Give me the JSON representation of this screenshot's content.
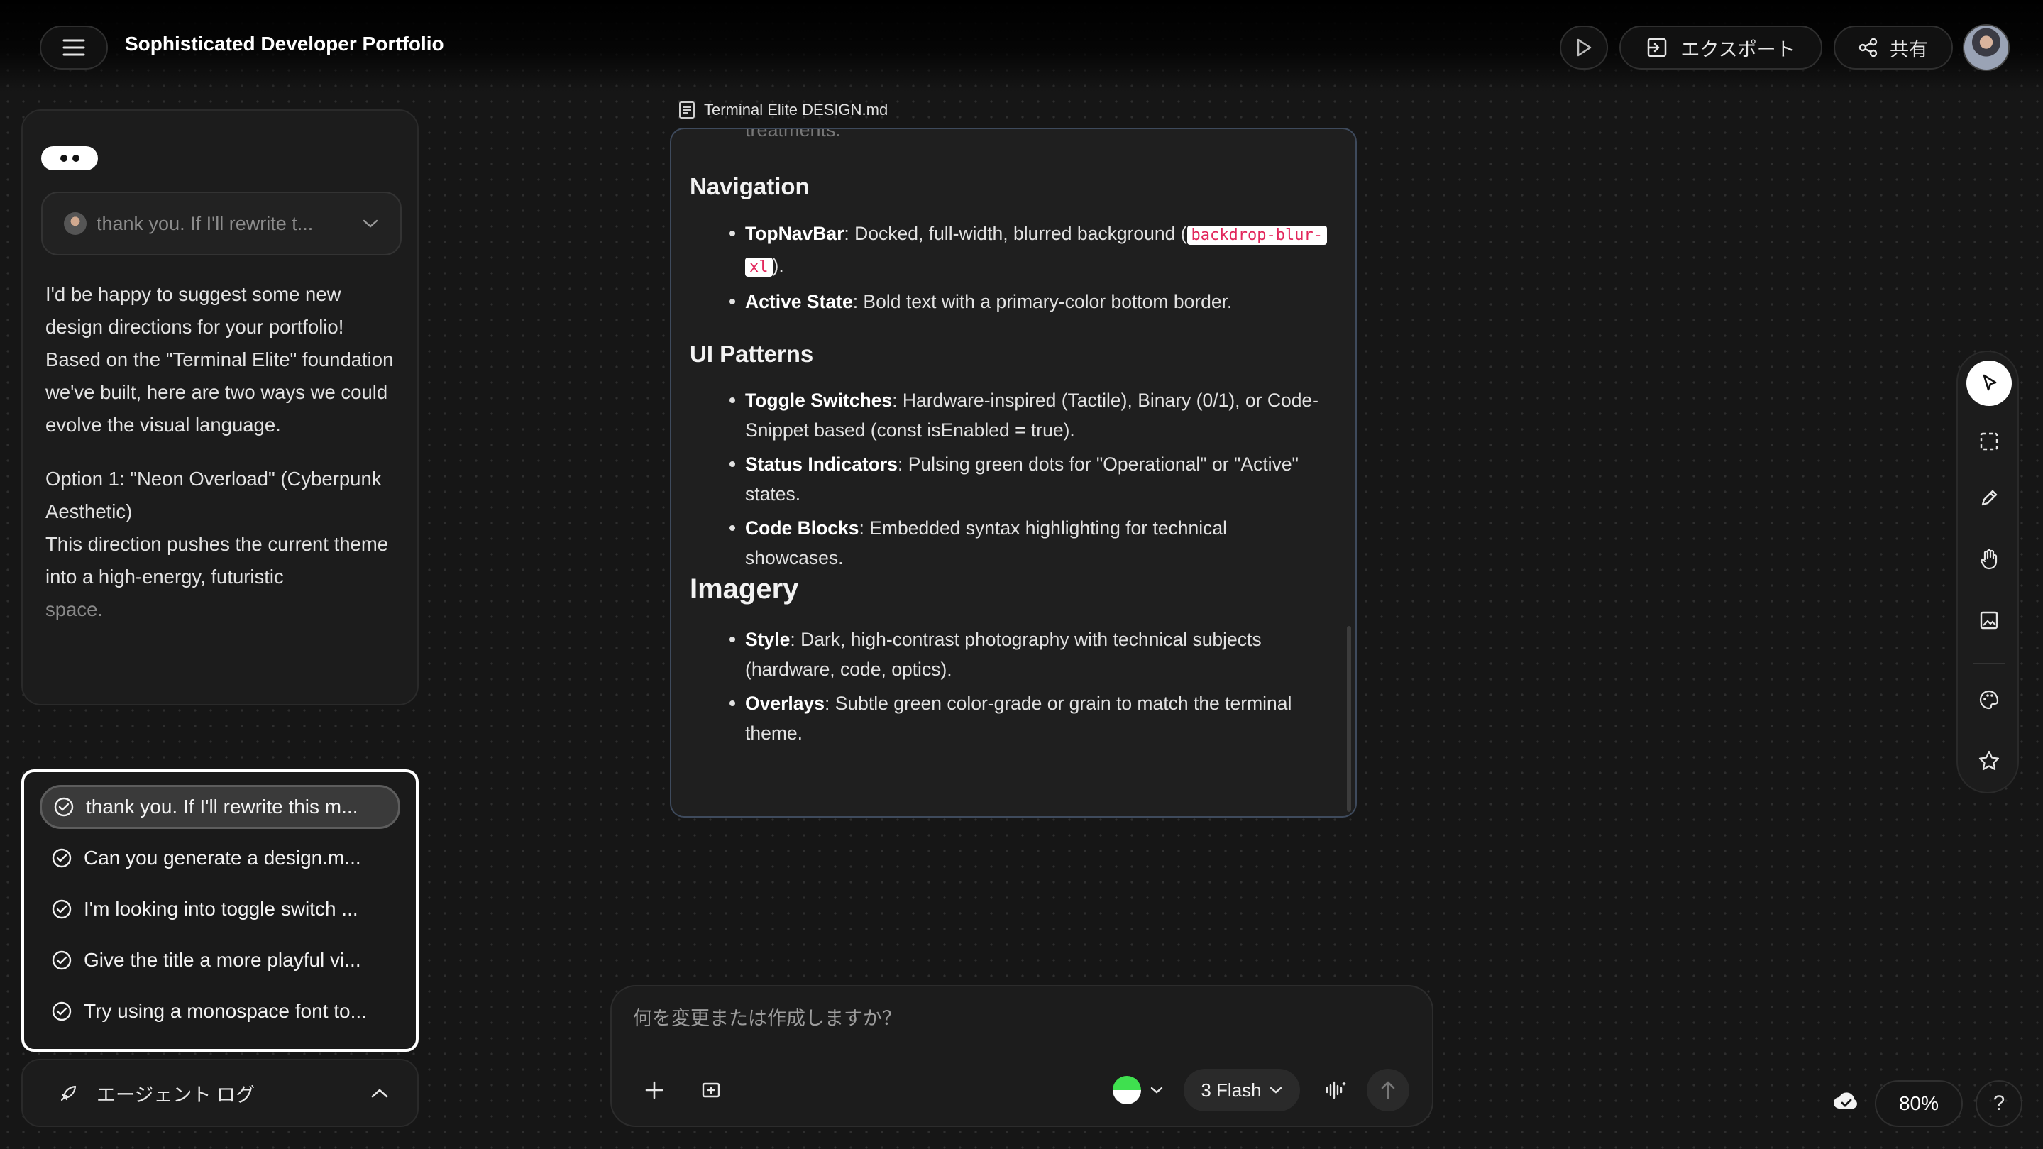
{
  "header": {
    "title": "Sophisticated Developer Portfolio",
    "export_label": "エクスポート",
    "share_label": "共有"
  },
  "chat": {
    "history_selected": "thank you. If I'll rewrite t...",
    "paragraph1": "I'd be happy to suggest some new design directions for your portfolio! Based on the \"Terminal Elite\" foundation we've built, here are two ways we could evolve the visual language.",
    "option_title": "Option 1: \"Neon Overload\" (Cyberpunk Aesthetic)",
    "option_body": "This direction pushes the current theme into a high-energy, futuristic",
    "option_body_fade": "space."
  },
  "agent_log": {
    "label": "エージェント ログ",
    "items": [
      "thank you. If I'll rewrite this m...",
      "Can you generate a design.m...",
      "I'm looking into toggle switch ...",
      "Give the title a more playful vi...",
      "Try using a monospace font to..."
    ]
  },
  "document": {
    "filename": "Terminal Elite DESIGN.md",
    "cut_text": "treatments.",
    "nav_heading": "Navigation",
    "nav_items": [
      {
        "term": "TopNavBar",
        "text_before": ": Docked, full-width, blurred background (",
        "code1": "backdrop-blur-",
        "code2": "xl",
        "text_after": ")."
      },
      {
        "term": "Active State",
        "text": ": Bold text with a primary-color bottom border."
      }
    ],
    "ui_heading": "UI Patterns",
    "ui_items": [
      {
        "term": "Toggle Switches",
        "text": ": Hardware-inspired (Tactile), Binary (0/1), or Code-Snippet based (const isEnabled = true)."
      },
      {
        "term": "Status Indicators",
        "text": ": Pulsing green dots for \"Operational\" or \"Active\" states."
      },
      {
        "term": "Code Blocks",
        "text": ": Embedded syntax highlighting for technical showcases."
      }
    ],
    "imagery_heading": "Imagery",
    "imagery_items": [
      {
        "term": "Style",
        "text": ": Dark, high-contrast photography with technical subjects (hardware, code, optics)."
      },
      {
        "term": "Overlays",
        "text": ": Subtle green color-grade or grain to match the terminal theme."
      }
    ]
  },
  "composer": {
    "placeholder": "何を変更または作成しますか？",
    "model_label": "3 Flash"
  },
  "zoom": "80%",
  "help_label": "?",
  "colors": {
    "background": "#161616",
    "panel": "#1c1c1c",
    "code_text": "#e2265b",
    "model_dot_green": "#3fe04f"
  },
  "icons": {
    "tools": [
      "cursor-icon",
      "select-area-icon",
      "pencil-icon",
      "hand-icon",
      "image-icon",
      "palette-icon",
      "star-icon"
    ]
  }
}
